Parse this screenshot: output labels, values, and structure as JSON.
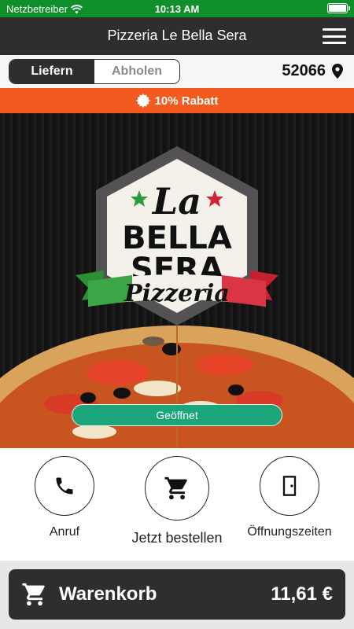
{
  "status_bar": {
    "carrier": "Netzbetreiber",
    "time": "10:13 AM"
  },
  "header": {
    "title": "Pizzeria Le Bella Sera"
  },
  "order_mode": {
    "options": [
      "Liefern",
      "Abholen"
    ],
    "selected": "Liefern",
    "postal_code": "52066"
  },
  "promo": {
    "text": "10% Rabatt"
  },
  "hero": {
    "logo_text": [
      "La",
      "BELLA",
      "SERA",
      "Pizzeria"
    ],
    "status_label": "Geöffnet"
  },
  "actions": [
    {
      "label": "Anruf",
      "icon": "phone-icon"
    },
    {
      "label": "Jetzt bestellen",
      "icon": "cart-icon"
    },
    {
      "label": "Öffnungszeiten",
      "icon": "door-icon"
    }
  ],
  "cart": {
    "label": "Warenkorb",
    "total": "11,61 €"
  },
  "colors": {
    "status_bar": "#0f8f2a",
    "header": "#2f2d2d",
    "promo": "#f25a1f",
    "open_pill": "#1aa57a"
  }
}
